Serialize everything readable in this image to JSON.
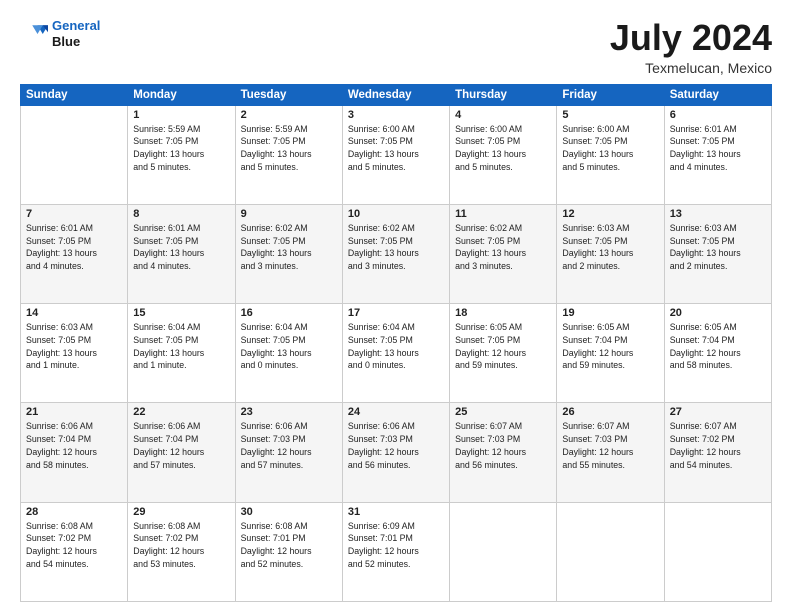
{
  "header": {
    "logo_line1": "General",
    "logo_line2": "Blue",
    "title": "July 2024",
    "subtitle": "Texmelucan, Mexico"
  },
  "days_of_week": [
    "Sunday",
    "Monday",
    "Tuesday",
    "Wednesday",
    "Thursday",
    "Friday",
    "Saturday"
  ],
  "weeks": [
    [
      {
        "day": "",
        "info": ""
      },
      {
        "day": "1",
        "info": "Sunrise: 5:59 AM\nSunset: 7:05 PM\nDaylight: 13 hours\nand 5 minutes."
      },
      {
        "day": "2",
        "info": "Sunrise: 5:59 AM\nSunset: 7:05 PM\nDaylight: 13 hours\nand 5 minutes."
      },
      {
        "day": "3",
        "info": "Sunrise: 6:00 AM\nSunset: 7:05 PM\nDaylight: 13 hours\nand 5 minutes."
      },
      {
        "day": "4",
        "info": "Sunrise: 6:00 AM\nSunset: 7:05 PM\nDaylight: 13 hours\nand 5 minutes."
      },
      {
        "day": "5",
        "info": "Sunrise: 6:00 AM\nSunset: 7:05 PM\nDaylight: 13 hours\nand 5 minutes."
      },
      {
        "day": "6",
        "info": "Sunrise: 6:01 AM\nSunset: 7:05 PM\nDaylight: 13 hours\nand 4 minutes."
      }
    ],
    [
      {
        "day": "7",
        "info": "Sunrise: 6:01 AM\nSunset: 7:05 PM\nDaylight: 13 hours\nand 4 minutes."
      },
      {
        "day": "8",
        "info": "Sunrise: 6:01 AM\nSunset: 7:05 PM\nDaylight: 13 hours\nand 4 minutes."
      },
      {
        "day": "9",
        "info": "Sunrise: 6:02 AM\nSunset: 7:05 PM\nDaylight: 13 hours\nand 3 minutes."
      },
      {
        "day": "10",
        "info": "Sunrise: 6:02 AM\nSunset: 7:05 PM\nDaylight: 13 hours\nand 3 minutes."
      },
      {
        "day": "11",
        "info": "Sunrise: 6:02 AM\nSunset: 7:05 PM\nDaylight: 13 hours\nand 3 minutes."
      },
      {
        "day": "12",
        "info": "Sunrise: 6:03 AM\nSunset: 7:05 PM\nDaylight: 13 hours\nand 2 minutes."
      },
      {
        "day": "13",
        "info": "Sunrise: 6:03 AM\nSunset: 7:05 PM\nDaylight: 13 hours\nand 2 minutes."
      }
    ],
    [
      {
        "day": "14",
        "info": "Sunrise: 6:03 AM\nSunset: 7:05 PM\nDaylight: 13 hours\nand 1 minute."
      },
      {
        "day": "15",
        "info": "Sunrise: 6:04 AM\nSunset: 7:05 PM\nDaylight: 13 hours\nand 1 minute."
      },
      {
        "day": "16",
        "info": "Sunrise: 6:04 AM\nSunset: 7:05 PM\nDaylight: 13 hours\nand 0 minutes."
      },
      {
        "day": "17",
        "info": "Sunrise: 6:04 AM\nSunset: 7:05 PM\nDaylight: 13 hours\nand 0 minutes."
      },
      {
        "day": "18",
        "info": "Sunrise: 6:05 AM\nSunset: 7:05 PM\nDaylight: 12 hours\nand 59 minutes."
      },
      {
        "day": "19",
        "info": "Sunrise: 6:05 AM\nSunset: 7:04 PM\nDaylight: 12 hours\nand 59 minutes."
      },
      {
        "day": "20",
        "info": "Sunrise: 6:05 AM\nSunset: 7:04 PM\nDaylight: 12 hours\nand 58 minutes."
      }
    ],
    [
      {
        "day": "21",
        "info": "Sunrise: 6:06 AM\nSunset: 7:04 PM\nDaylight: 12 hours\nand 58 minutes."
      },
      {
        "day": "22",
        "info": "Sunrise: 6:06 AM\nSunset: 7:04 PM\nDaylight: 12 hours\nand 57 minutes."
      },
      {
        "day": "23",
        "info": "Sunrise: 6:06 AM\nSunset: 7:03 PM\nDaylight: 12 hours\nand 57 minutes."
      },
      {
        "day": "24",
        "info": "Sunrise: 6:06 AM\nSunset: 7:03 PM\nDaylight: 12 hours\nand 56 minutes."
      },
      {
        "day": "25",
        "info": "Sunrise: 6:07 AM\nSunset: 7:03 PM\nDaylight: 12 hours\nand 56 minutes."
      },
      {
        "day": "26",
        "info": "Sunrise: 6:07 AM\nSunset: 7:03 PM\nDaylight: 12 hours\nand 55 minutes."
      },
      {
        "day": "27",
        "info": "Sunrise: 6:07 AM\nSunset: 7:02 PM\nDaylight: 12 hours\nand 54 minutes."
      }
    ],
    [
      {
        "day": "28",
        "info": "Sunrise: 6:08 AM\nSunset: 7:02 PM\nDaylight: 12 hours\nand 54 minutes."
      },
      {
        "day": "29",
        "info": "Sunrise: 6:08 AM\nSunset: 7:02 PM\nDaylight: 12 hours\nand 53 minutes."
      },
      {
        "day": "30",
        "info": "Sunrise: 6:08 AM\nSunset: 7:01 PM\nDaylight: 12 hours\nand 52 minutes."
      },
      {
        "day": "31",
        "info": "Sunrise: 6:09 AM\nSunset: 7:01 PM\nDaylight: 12 hours\nand 52 minutes."
      },
      {
        "day": "",
        "info": ""
      },
      {
        "day": "",
        "info": ""
      },
      {
        "day": "",
        "info": ""
      }
    ]
  ]
}
